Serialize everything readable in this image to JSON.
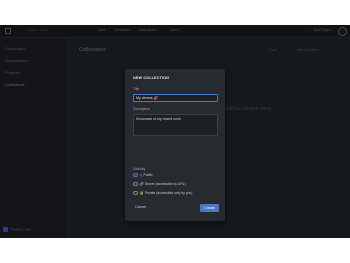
{
  "topbar": {
    "brand": "TravelPro Studio",
    "nav": [
      "Apps",
      "Schedules",
      "Marketplace",
      "More ▾"
    ],
    "new_project": "+ New Project",
    "avatar_initials": "AB"
  },
  "sidebar": {
    "items": [
      "Dashboard",
      "Repositories",
      "Projects",
      "Collections"
    ],
    "workspace": "TravelPro Stu ⌄"
  },
  "main": {
    "title": "Collections",
    "actions": [
      "+ Add",
      "+ New Collection"
    ],
    "empty_text": "will be shown here."
  },
  "modal": {
    "title": "NEW COLLECTION",
    "title_label": "Title",
    "title_value": "My demos 🎉",
    "description_label": "Description",
    "description_value": "Showcase of my recent work",
    "visibility_label": "Visibility",
    "options": [
      {
        "icon": "◎",
        "label": "Public",
        "selected": true
      },
      {
        "icon": "🔗",
        "label": "Secret (accessible by URL)",
        "selected": false
      },
      {
        "icon": "🔒",
        "label": "Private (accessible only by you)",
        "selected": false
      }
    ],
    "cancel_label": "Cancel",
    "create_label": "Create"
  },
  "colors": {
    "accent": "#4a78c2",
    "background": "#1e2226",
    "modal": "#272b30"
  }
}
